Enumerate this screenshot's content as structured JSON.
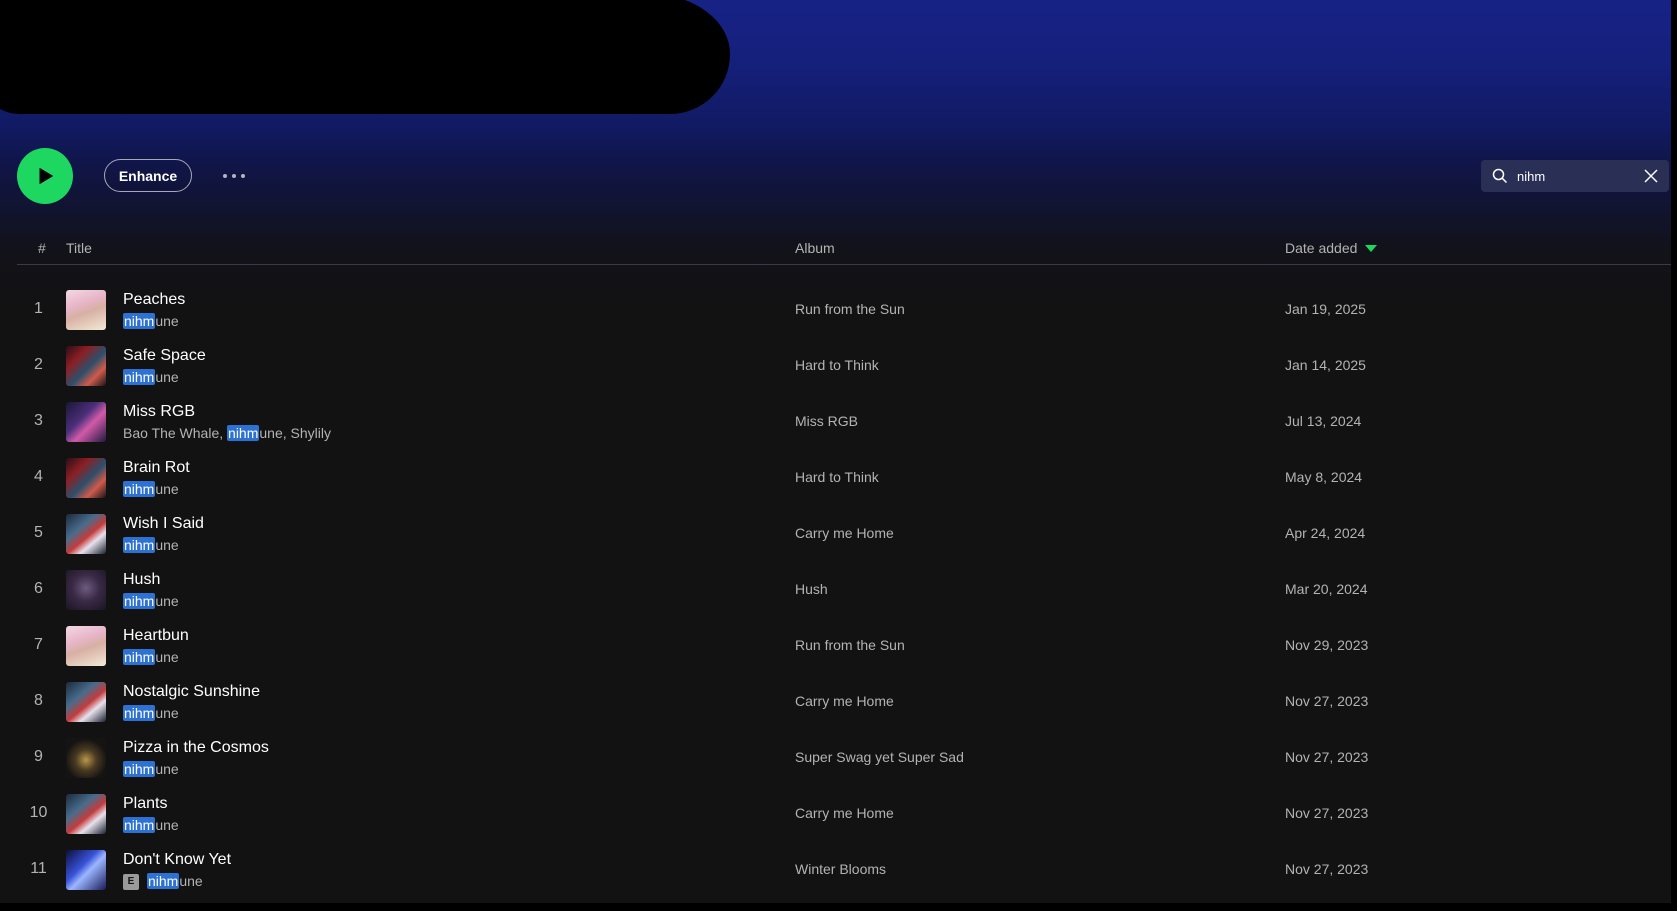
{
  "actions": {
    "enhance_label": "Enhance"
  },
  "search": {
    "query": "nihm"
  },
  "table": {
    "headers": {
      "number": "#",
      "title": "Title",
      "album": "Album",
      "date_added": "Date added"
    },
    "sort": {
      "column": "date_added",
      "direction": "descending"
    },
    "rows": [
      {
        "num": "1",
        "title": "Peaches",
        "artist_pre": "",
        "artist_hl": "nihm",
        "artist_post": "une",
        "explicit": false,
        "album": "Run from the Sun",
        "date": "Jan 19, 2025",
        "art": "art-peaches"
      },
      {
        "num": "2",
        "title": "Safe Space",
        "artist_pre": "",
        "artist_hl": "nihm",
        "artist_post": "une",
        "explicit": false,
        "album": "Hard to Think",
        "date": "Jan 14, 2025",
        "art": "art-hard"
      },
      {
        "num": "3",
        "title": "Miss RGB",
        "artist_pre": "Bao The Whale, ",
        "artist_hl": "nihm",
        "artist_post": "une, Shylily",
        "explicit": false,
        "album": "Miss RGB",
        "date": "Jul 13, 2024",
        "art": "art-rgb"
      },
      {
        "num": "4",
        "title": "Brain Rot",
        "artist_pre": "",
        "artist_hl": "nihm",
        "artist_post": "une",
        "explicit": false,
        "album": "Hard to Think",
        "date": "May 8, 2024",
        "art": "art-hard"
      },
      {
        "num": "5",
        "title": "Wish I Said",
        "artist_pre": "",
        "artist_hl": "nihm",
        "artist_post": "une",
        "explicit": false,
        "album": "Carry me Home",
        "date": "Apr 24, 2024",
        "art": "art-carry"
      },
      {
        "num": "6",
        "title": "Hush",
        "artist_pre": "",
        "artist_hl": "nihm",
        "artist_post": "une",
        "explicit": false,
        "album": "Hush",
        "date": "Mar 20, 2024",
        "art": "art-hush"
      },
      {
        "num": "7",
        "title": "Heartbun",
        "artist_pre": "",
        "artist_hl": "nihm",
        "artist_post": "une",
        "explicit": false,
        "album": "Run from the Sun",
        "date": "Nov 29, 2023",
        "art": "art-peaches"
      },
      {
        "num": "8",
        "title": "Nostalgic Sunshine",
        "artist_pre": "",
        "artist_hl": "nihm",
        "artist_post": "une",
        "explicit": false,
        "album": "Carry me Home",
        "date": "Nov 27, 2023",
        "art": "art-carry"
      },
      {
        "num": "9",
        "title": "Pizza in the Cosmos",
        "artist_pre": "",
        "artist_hl": "nihm",
        "artist_post": "une",
        "explicit": false,
        "album": "Super Swag yet Super Sad",
        "date": "Nov 27, 2023",
        "art": "art-pizza"
      },
      {
        "num": "10",
        "title": "Plants",
        "artist_pre": "",
        "artist_hl": "nihm",
        "artist_post": "une",
        "explicit": false,
        "album": "Carry me Home",
        "date": "Nov 27, 2023",
        "art": "art-carry"
      },
      {
        "num": "11",
        "title": "Don't Know Yet",
        "artist_pre": "",
        "artist_hl": "nihm",
        "artist_post": "une",
        "explicit": true,
        "explicit_label": "E",
        "album": "Winter Blooms",
        "date": "Nov 27, 2023",
        "art": "art-winter"
      }
    ]
  },
  "icons": {
    "play": "play-icon",
    "more": "more-options-icon",
    "search": "search-icon",
    "clear": "close-icon",
    "sort": "sort-descending-icon"
  },
  "colors": {
    "accent": "#1ed760",
    "highlight": "#2d72d2",
    "header_blue": "#172285",
    "background": "#121212"
  }
}
